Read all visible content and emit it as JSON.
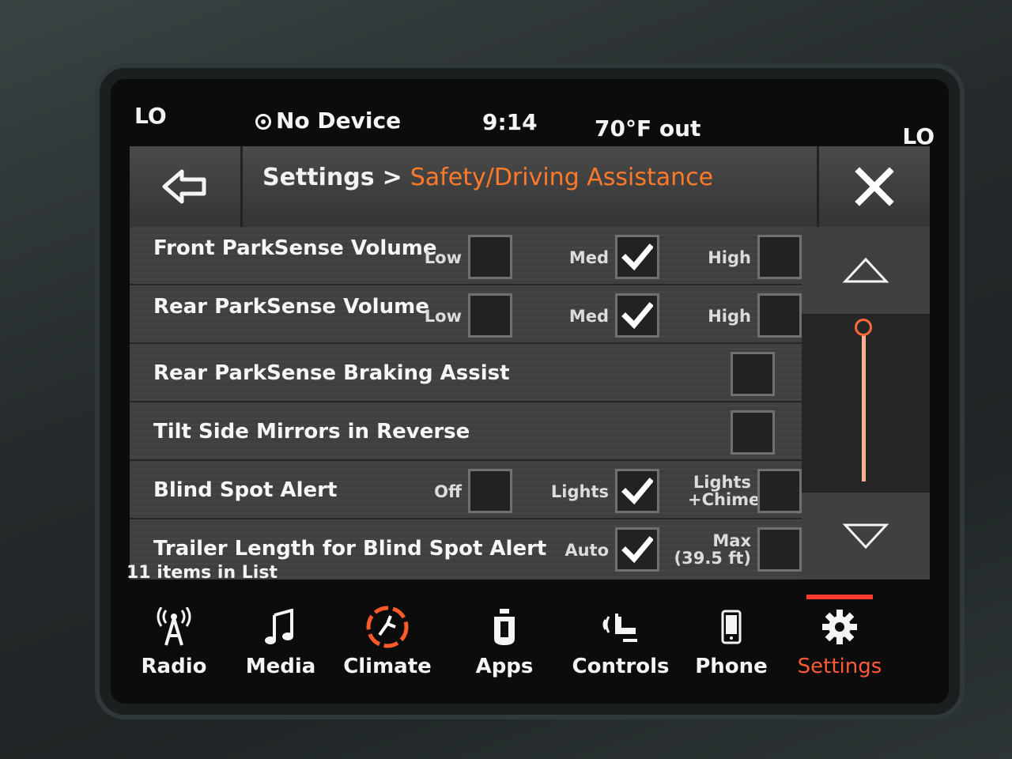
{
  "status": {
    "left_zone_temp": "LO",
    "device": "No Device",
    "time": "9:14",
    "outside_temp": "70°F out",
    "right_zone_temp": "LO"
  },
  "header": {
    "breadcrumb_root": "Settings",
    "separator": ">",
    "current": "Safety/Driving Assistance"
  },
  "rows": [
    {
      "label": "Front ParkSense Volume",
      "options": [
        {
          "label": "Low",
          "checked": false
        },
        {
          "label": "Med",
          "checked": true
        },
        {
          "label": "High",
          "checked": false
        }
      ]
    },
    {
      "label": "Rear ParkSense Volume",
      "options": [
        {
          "label": "Low",
          "checked": false
        },
        {
          "label": "Med",
          "checked": true
        },
        {
          "label": "High",
          "checked": false
        }
      ]
    },
    {
      "label": "Rear ParkSense Braking Assist",
      "checked": false
    },
    {
      "label": "Tilt Side Mirrors in Reverse",
      "checked": false
    },
    {
      "label": "Blind Spot Alert",
      "options": [
        {
          "label": "Off",
          "checked": false
        },
        {
          "label": "Lights",
          "checked": true
        },
        {
          "label": "Lights +Chime",
          "checked": false
        }
      ]
    },
    {
      "label": "Trailer Length for Blind Spot Alert",
      "options": [
        {
          "label": "Auto",
          "checked": true
        },
        {
          "label": "Max (39.5 ft)",
          "checked": false
        }
      ]
    }
  ],
  "list_count": "11 items in List",
  "scroll_position": 0,
  "nav": [
    {
      "label": "Radio",
      "icon": "radio-tower-icon"
    },
    {
      "label": "Media",
      "icon": "music-note-icon"
    },
    {
      "label": "Climate",
      "icon": "climate-icon"
    },
    {
      "label": "Apps",
      "icon": "apps-icon"
    },
    {
      "label": "Controls",
      "icon": "controls-icon"
    },
    {
      "label": "Phone",
      "icon": "phone-icon"
    },
    {
      "label": "Settings",
      "icon": "gear-icon",
      "active": true
    }
  ],
  "colors": {
    "accent": "#ff7a2a",
    "active_nav": "#ff5a34",
    "scroll_thumb": "#ff6a3a"
  }
}
